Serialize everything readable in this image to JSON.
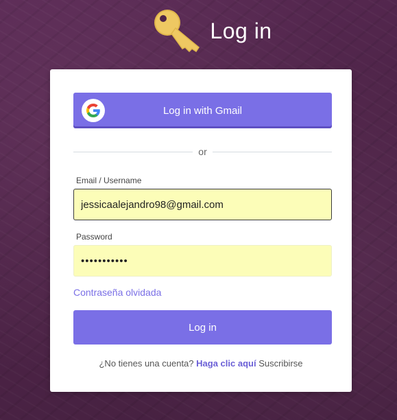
{
  "header": {
    "title": "Log in",
    "icon": "key-icon",
    "icon_color": "#e8c35a"
  },
  "gmail": {
    "label": "Log in with Gmail",
    "icon": "google-g-icon"
  },
  "divider": {
    "text": "or"
  },
  "email": {
    "label": "Email / Username",
    "value": "jessicaalejandro98@gmail.com"
  },
  "password": {
    "label": "Password",
    "value": "•••••••••••"
  },
  "forgot_link": "Contraseña olvidada",
  "login_button": "Log in",
  "signup": {
    "prompt": "¿No tienes una cuenta?",
    "link": "Haga clic aquí",
    "suffix": "Suscribirse"
  },
  "colors": {
    "accent": "#7a6fe6",
    "field_bg": "#fcfdb8",
    "background": "#4e2448"
  }
}
